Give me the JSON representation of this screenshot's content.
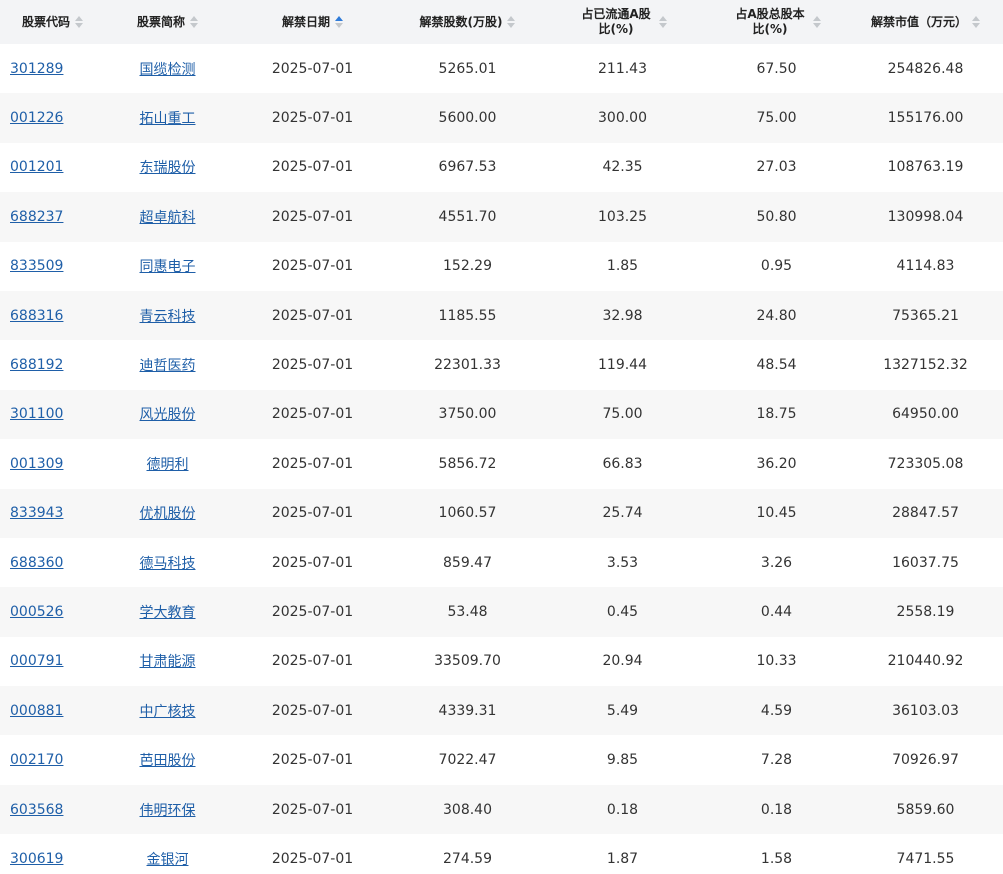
{
  "colors": {
    "header_bg": "#f3f4f6",
    "stripe_bg": "#f7f7f7",
    "link": "#1f5fa8",
    "sort_inactive": "#c4c8cc",
    "sort_active": "#2f7bd9"
  },
  "table": {
    "headers": [
      {
        "key": "code",
        "label": "股票代码",
        "sort": "none"
      },
      {
        "key": "name",
        "label": "股票简称",
        "sort": "none"
      },
      {
        "key": "date",
        "label": "解禁日期",
        "sort": "asc"
      },
      {
        "key": "shares",
        "label": "解禁股数(万股)",
        "sort": "none"
      },
      {
        "key": "float_ratio",
        "label": "占已流通A股比(%)",
        "sort": "none"
      },
      {
        "key": "total_ratio",
        "label": "占A股总股本比(%)",
        "sort": "none"
      },
      {
        "key": "market_value",
        "label": "解禁市值（万元）",
        "sort": "none"
      }
    ],
    "rows": [
      {
        "code": "301289",
        "name": "国缆检测",
        "date": "2025-07-01",
        "shares": "5265.01",
        "float_ratio": "211.43",
        "total_ratio": "67.50",
        "market_value": "254826.48"
      },
      {
        "code": "001226",
        "name": "拓山重工",
        "date": "2025-07-01",
        "shares": "5600.00",
        "float_ratio": "300.00",
        "total_ratio": "75.00",
        "market_value": "155176.00"
      },
      {
        "code": "001201",
        "name": "东瑞股份",
        "date": "2025-07-01",
        "shares": "6967.53",
        "float_ratio": "42.35",
        "total_ratio": "27.03",
        "market_value": "108763.19"
      },
      {
        "code": "688237",
        "name": "超卓航科",
        "date": "2025-07-01",
        "shares": "4551.70",
        "float_ratio": "103.25",
        "total_ratio": "50.80",
        "market_value": "130998.04"
      },
      {
        "code": "833509",
        "name": "同惠电子",
        "date": "2025-07-01",
        "shares": "152.29",
        "float_ratio": "1.85",
        "total_ratio": "0.95",
        "market_value": "4114.83"
      },
      {
        "code": "688316",
        "name": "青云科技",
        "date": "2025-07-01",
        "shares": "1185.55",
        "float_ratio": "32.98",
        "total_ratio": "24.80",
        "market_value": "75365.21"
      },
      {
        "code": "688192",
        "name": "迪哲医药",
        "date": "2025-07-01",
        "shares": "22301.33",
        "float_ratio": "119.44",
        "total_ratio": "48.54",
        "market_value": "1327152.32"
      },
      {
        "code": "301100",
        "name": "风光股份",
        "date": "2025-07-01",
        "shares": "3750.00",
        "float_ratio": "75.00",
        "total_ratio": "18.75",
        "market_value": "64950.00"
      },
      {
        "code": "001309",
        "name": "德明利",
        "date": "2025-07-01",
        "shares": "5856.72",
        "float_ratio": "66.83",
        "total_ratio": "36.20",
        "market_value": "723305.08"
      },
      {
        "code": "833943",
        "name": "优机股份",
        "date": "2025-07-01",
        "shares": "1060.57",
        "float_ratio": "25.74",
        "total_ratio": "10.45",
        "market_value": "28847.57"
      },
      {
        "code": "688360",
        "name": "德马科技",
        "date": "2025-07-01",
        "shares": "859.47",
        "float_ratio": "3.53",
        "total_ratio": "3.26",
        "market_value": "16037.75"
      },
      {
        "code": "000526",
        "name": "学大教育",
        "date": "2025-07-01",
        "shares": "53.48",
        "float_ratio": "0.45",
        "total_ratio": "0.44",
        "market_value": "2558.19"
      },
      {
        "code": "000791",
        "name": "甘肃能源",
        "date": "2025-07-01",
        "shares": "33509.70",
        "float_ratio": "20.94",
        "total_ratio": "10.33",
        "market_value": "210440.92"
      },
      {
        "code": "000881",
        "name": "中广核技",
        "date": "2025-07-01",
        "shares": "4339.31",
        "float_ratio": "5.49",
        "total_ratio": "4.59",
        "market_value": "36103.03"
      },
      {
        "code": "002170",
        "name": "芭田股份",
        "date": "2025-07-01",
        "shares": "7022.47",
        "float_ratio": "9.85",
        "total_ratio": "7.28",
        "market_value": "70926.97"
      },
      {
        "code": "603568",
        "name": "伟明环保",
        "date": "2025-07-01",
        "shares": "308.40",
        "float_ratio": "0.18",
        "total_ratio": "0.18",
        "market_value": "5859.60"
      },
      {
        "code": "300619",
        "name": "金银河",
        "date": "2025-07-01",
        "shares": "274.59",
        "float_ratio": "1.87",
        "total_ratio": "1.58",
        "market_value": "7471.55"
      }
    ]
  }
}
